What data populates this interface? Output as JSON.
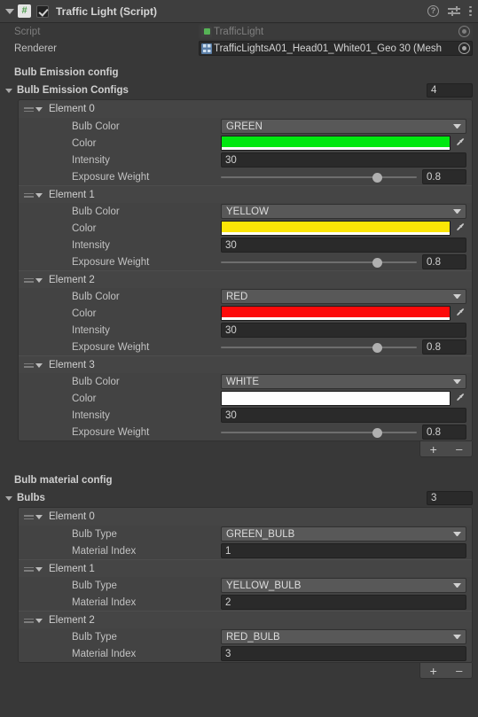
{
  "header": {
    "title": "Traffic Light (Script)",
    "enabled_checkbox": true,
    "script_badge": "#",
    "help_icon": "?",
    "icons": [
      "help-icon",
      "preset-icon",
      "kebab-menu-icon"
    ]
  },
  "fields": {
    "script_label": "Script",
    "script_value": "TrafficLight",
    "renderer_label": "Renderer",
    "renderer_value": "TrafficLightsA01_Head01_White01_Geo 30 (Mesh"
  },
  "emission": {
    "section_label": "Bulb Emission config",
    "list_label": "Bulb Emission Configs",
    "size": "4",
    "field_labels": {
      "bulb_color": "Bulb Color",
      "color": "Color",
      "intensity": "Intensity",
      "exposure_weight": "Exposure Weight"
    },
    "elements": [
      {
        "title": "Element 0",
        "bulb_color": "GREEN",
        "color_hex": "#00E810",
        "intensity": "30",
        "exposure_weight": "0.8",
        "exposure_pct": 80
      },
      {
        "title": "Element 1",
        "bulb_color": "YELLOW",
        "color_hex": "#FBE506",
        "intensity": "30",
        "exposure_weight": "0.8",
        "exposure_pct": 80
      },
      {
        "title": "Element 2",
        "bulb_color": "RED",
        "color_hex": "#FC0A0A",
        "intensity": "30",
        "exposure_weight": "0.8",
        "exposure_pct": 80
      },
      {
        "title": "Element 3",
        "bulb_color": "WHITE",
        "color_hex": "#FFFFFF",
        "intensity": "30",
        "exposure_weight": "0.8",
        "exposure_pct": 80
      }
    ],
    "footer": {
      "add": "+",
      "remove": "–"
    }
  },
  "material": {
    "section_label": "Bulb material config",
    "list_label": "Bulbs",
    "size": "3",
    "field_labels": {
      "bulb_type": "Bulb Type",
      "material_index": "Material Index"
    },
    "elements": [
      {
        "title": "Element 0",
        "bulb_type": "GREEN_BULB",
        "material_index": "1"
      },
      {
        "title": "Element 1",
        "bulb_type": "YELLOW_BULB",
        "material_index": "2"
      },
      {
        "title": "Element 2",
        "bulb_type": "RED_BULB",
        "material_index": "3"
      }
    ],
    "footer": {
      "add": "+",
      "remove": "–"
    }
  }
}
